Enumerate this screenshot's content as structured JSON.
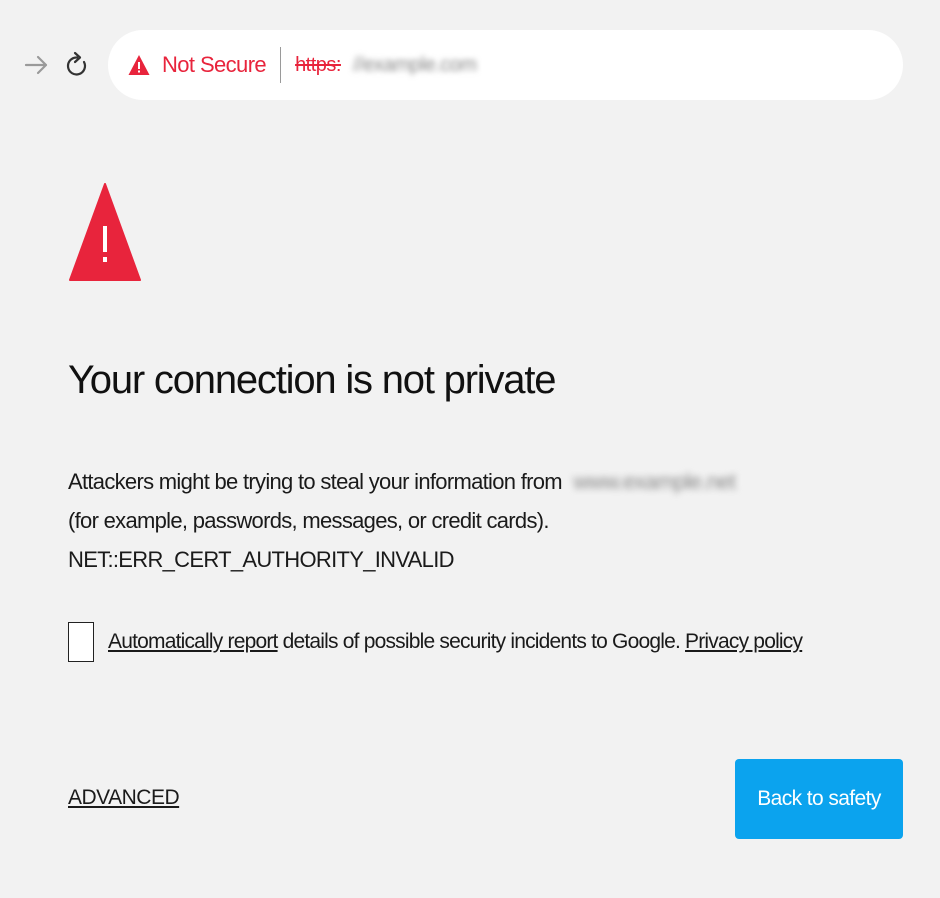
{
  "toolbar": {
    "forward_icon": "arrow-right-icon",
    "reload_icon": "reload-icon"
  },
  "omnibox": {
    "security_icon": "warning-triangle-icon",
    "security_label": "Not Secure",
    "scheme": "https:",
    "host": "//example.com"
  },
  "interstitial": {
    "warning_icon": "warning-triangle-icon",
    "title": "Your connection is not private",
    "description_lead": "Attackers might be trying to steal your information from",
    "description_host": "www.example.net",
    "description_rest": "(for example, passwords, messages, or credit cards). NET::ERR_CERT_AUTHORITY_INVALID",
    "report_link": "Automatically report",
    "report_text": " details of possible security incidents to Google. ",
    "privacy_link": "Privacy policy",
    "report_checked": false,
    "advanced_label": "ADVANCED",
    "back_label": "Back to safety"
  },
  "colors": {
    "background": "#f2f2f2",
    "danger": "#e8243c",
    "primary_button": "#0ba3ee"
  }
}
